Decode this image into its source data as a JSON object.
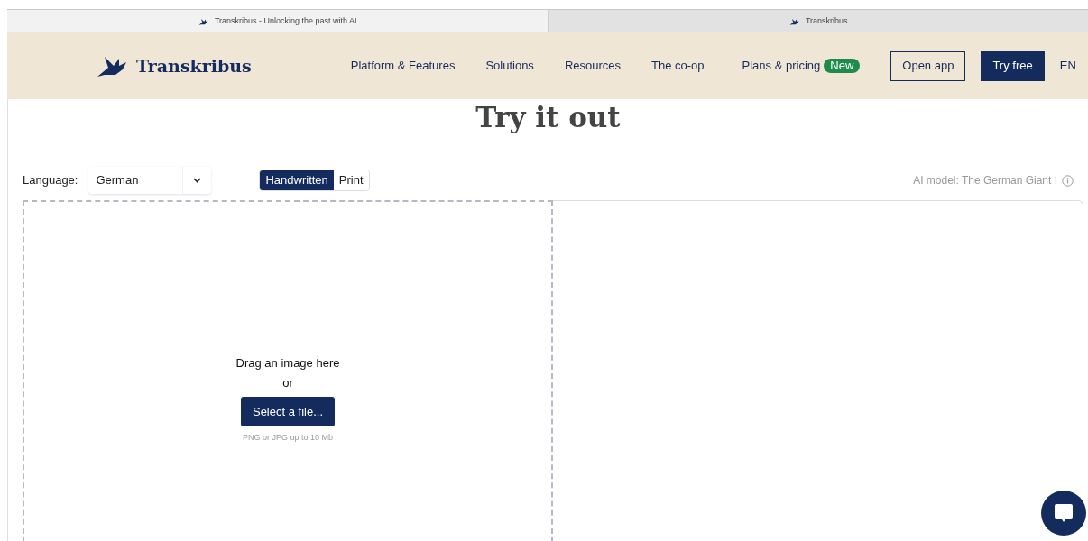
{
  "browser_tabs": [
    {
      "title": "Transkribus - Unlocking the past with AI",
      "selected": true
    },
    {
      "title": "Transkribus",
      "selected": false
    }
  ],
  "header": {
    "logo": "Transkribus",
    "nav": [
      {
        "label": "Platform & Features"
      },
      {
        "label": "Solutions"
      },
      {
        "label": "Resources"
      },
      {
        "label": "The co-op"
      },
      {
        "label": "Plans & pricing",
        "badge": "New"
      }
    ],
    "open_app": "Open app",
    "try_free": "Try free",
    "language": "EN"
  },
  "title": "Try it out",
  "language_label": "Language:",
  "language_value": "German",
  "mode_toggle": [
    {
      "label": "Handwritten",
      "selected": true
    },
    {
      "label": "Print",
      "selected": false
    }
  ],
  "ai_model": "AI model: The German Giant I",
  "upload": {
    "prompt": "Drag an image here",
    "or": "or",
    "button": "Select a file...",
    "hint": "PNG or JPG up to 10 Mb"
  }
}
